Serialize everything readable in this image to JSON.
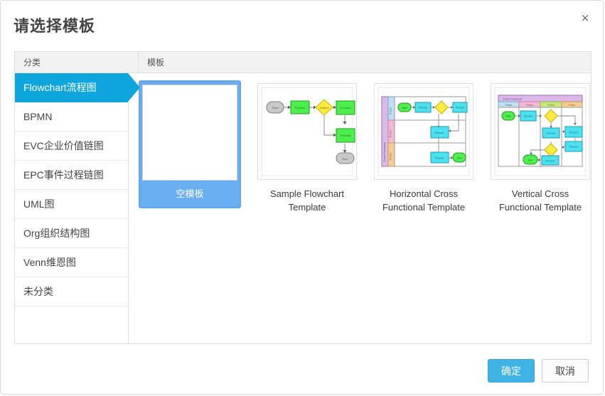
{
  "dialog": {
    "title": "请选择模板",
    "close_label": "×"
  },
  "table": {
    "headers": {
      "category": "分类",
      "template": "模板"
    }
  },
  "sidebar": {
    "items": [
      {
        "label": "Flowchart流程图",
        "selected": true
      },
      {
        "label": "BPMN",
        "selected": false
      },
      {
        "label": "EVC企业价值链图",
        "selected": false
      },
      {
        "label": "EPC事件过程链图",
        "selected": false
      },
      {
        "label": "UML图",
        "selected": false
      },
      {
        "label": "Org组织结构图",
        "selected": false
      },
      {
        "label": "Venn维恩图",
        "selected": false
      },
      {
        "label": "未分类",
        "selected": false
      }
    ]
  },
  "templates": [
    {
      "name": "空模板",
      "kind": "blank",
      "selected": true
    },
    {
      "name": "Sample Flowchart Template",
      "kind": "flowchart",
      "selected": false
    },
    {
      "name": "Horizontal Cross Functional Template",
      "kind": "horizontal-swimlane",
      "selected": false
    },
    {
      "name": "Vertical Cross Functional Template",
      "kind": "vertical-swimlane",
      "selected": false
    }
  ],
  "footer": {
    "ok_label": "确定",
    "cancel_label": "取消"
  },
  "colors": {
    "accent_blue": "#0fa6de",
    "selection_blue": "#6aaef2",
    "ok_button": "#3fb3e3",
    "node_green": "#4cef4c",
    "node_cyan": "#4de1ef",
    "node_yellow": "#ffec3f",
    "node_gray": "#c8c8c8",
    "lane_purple": "#dcb9e8",
    "lane_blue": "#bfe0f5",
    "lane_pink": "#f2b9d4",
    "lane_orange": "#f5cc94"
  }
}
